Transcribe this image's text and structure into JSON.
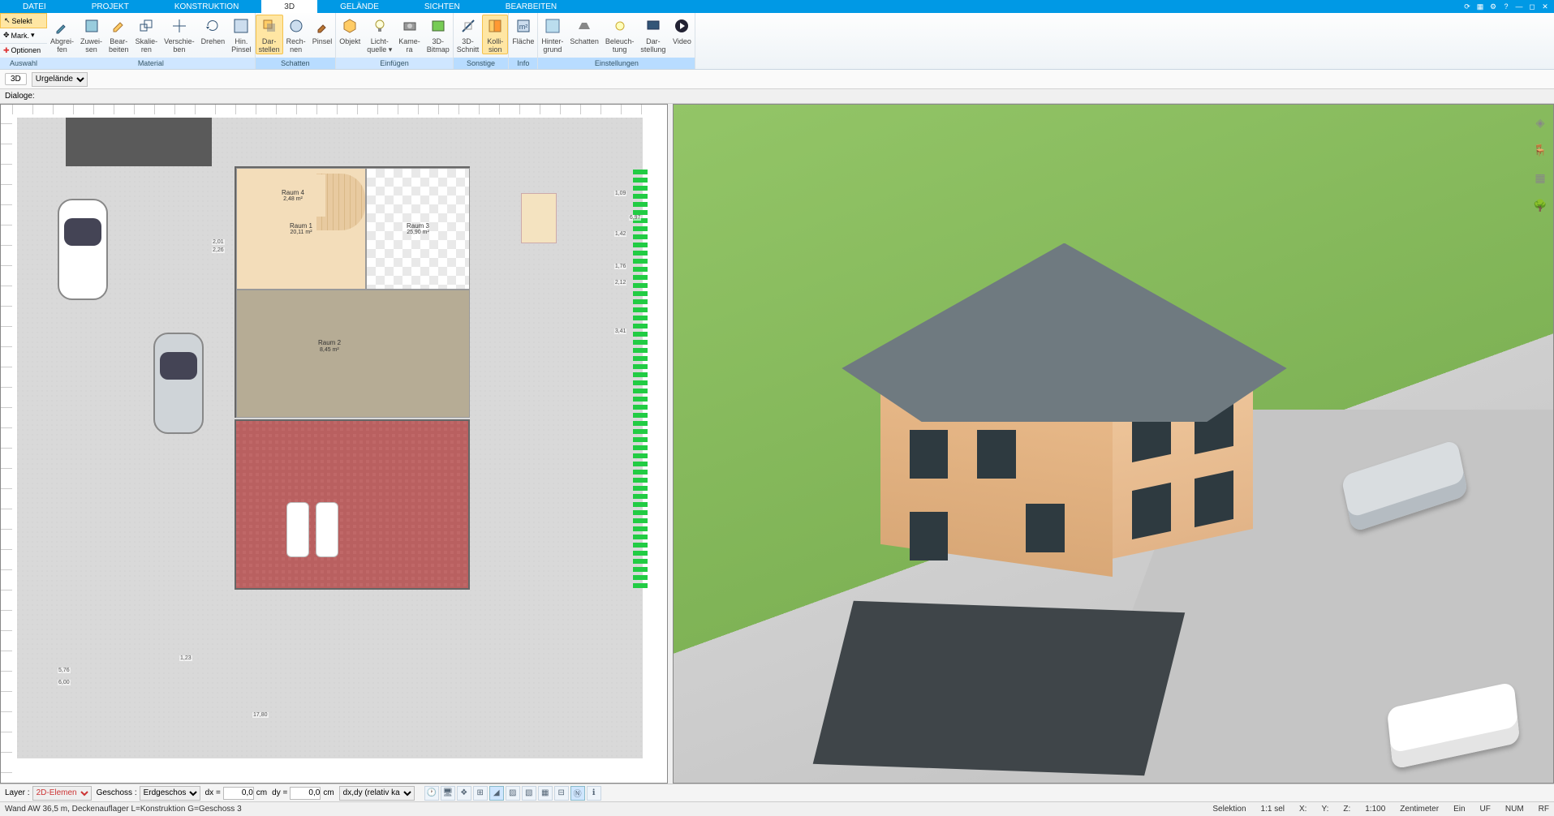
{
  "menu": {
    "tabs": [
      "DATEI",
      "PROJEKT",
      "KONSTRUKTION",
      "3D",
      "GELÄNDE",
      "SICHTEN",
      "BEARBEITEN"
    ],
    "active": 3
  },
  "ribbon_left": {
    "selekt": "Selekt",
    "mark": "Mark.",
    "optionen": "Optionen",
    "group": "Auswahl"
  },
  "ribbon": {
    "material": {
      "label": "Material",
      "items": [
        {
          "l1": "Abgrei-",
          "l2": "fen"
        },
        {
          "l1": "Zuwei-",
          "l2": "sen"
        },
        {
          "l1": "Bear-",
          "l2": "beiten"
        },
        {
          "l1": "Skalie-",
          "l2": "ren"
        },
        {
          "l1": "Verschie-",
          "l2": "ben"
        },
        {
          "l1": "Drehen",
          "l2": ""
        },
        {
          "l1": "Hin.",
          "l2": "Pinsel"
        }
      ]
    },
    "schatten": {
      "label": "Schatten",
      "items": [
        {
          "l1": "Dar-",
          "l2": "stellen",
          "active": true
        },
        {
          "l1": "Rech-",
          "l2": "nen"
        },
        {
          "l1": "Pinsel",
          "l2": ""
        }
      ]
    },
    "einfuegen": {
      "label": "Einfügen",
      "items": [
        {
          "l1": "Objekt",
          "l2": ""
        },
        {
          "l1": "Licht-",
          "l2": "quelle ▾"
        },
        {
          "l1": "Kame-",
          "l2": "ra"
        },
        {
          "l1": "3D-",
          "l2": "Bitmap"
        }
      ]
    },
    "sonstige": {
      "label": "Sonstige",
      "items": [
        {
          "l1": "3D-",
          "l2": "Schnitt"
        },
        {
          "l1": "Kolli-",
          "l2": "sion",
          "active": true
        }
      ]
    },
    "info": {
      "label": "Info",
      "items": [
        {
          "l1": "Fläche",
          "l2": ""
        }
      ]
    },
    "einstellungen": {
      "label": "Einstellungen",
      "items": [
        {
          "l1": "Hinter-",
          "l2": "grund"
        },
        {
          "l1": "Schatten",
          "l2": ""
        },
        {
          "l1": "Beleuch-",
          "l2": "tung"
        },
        {
          "l1": "Dar-",
          "l2": "stellung"
        },
        {
          "l1": "Video",
          "l2": ""
        }
      ]
    }
  },
  "subbar": {
    "mode": "3D",
    "layer": "Urgelände"
  },
  "dialoge": "Dialoge:",
  "rooms": {
    "r1": {
      "name": "Raum 1",
      "area": "20,11 m²"
    },
    "r2": {
      "name": "Raum 2",
      "area": "8,45 m²"
    },
    "r3": {
      "name": "Raum 3",
      "area": "25,90 m²"
    },
    "r4": {
      "name": "Raum 4",
      "area": "2,48 m²"
    }
  },
  "dims": {
    "d1": "2,01",
    "d2": "2,26",
    "d3": "1,76",
    "d4": "3,41",
    "d5": "2,12",
    "d6": "1,42",
    "d7": "1,09",
    "d8": "6,97",
    "d9": "6,00",
    "d10": "5,76",
    "d11": "1,23",
    "d12": "17,80"
  },
  "bottom": {
    "layer_label": "Layer :",
    "layer_value": "2D-Elemen",
    "geschoss_label": "Geschoss :",
    "geschoss_value": "Erdgeschos",
    "dx": "dx =",
    "dx_v": "0,0",
    "cm": "cm",
    "dy": "dy =",
    "dy_v": "0,0",
    "mode": "dx,dy (relativ ka"
  },
  "status": {
    "left": "Wand AW 36,5 m, Deckenauflager L=Konstruktion G=Geschoss 3",
    "selektion": "Selektion",
    "sel": "1:1 sel",
    "x": "X:",
    "y": "Y:",
    "z": "Z:",
    "scale": "1:100",
    "unit": "Zentimeter",
    "ein": "Ein",
    "uf": "UF",
    "num": "NUM",
    "rf": "RF"
  }
}
